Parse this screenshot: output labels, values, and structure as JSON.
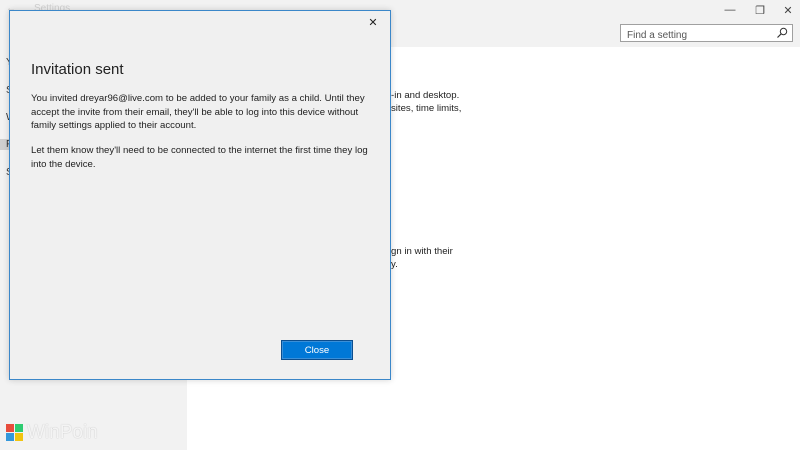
{
  "window": {
    "title": "Settings",
    "minimize_glyph": "—",
    "maximize_glyph": "❐",
    "close_glyph": "✕"
  },
  "search": {
    "placeholder": "Find a setting",
    "icon": "search-icon"
  },
  "sidebar": {
    "letters": [
      "Y",
      "S",
      "W",
      "F",
      "S"
    ]
  },
  "background_text": {
    "line1": "-in and desktop.",
    "line2": "sites, time limits,",
    "line3": "gn in with their",
    "line4": "y."
  },
  "dialog": {
    "close_glyph": "✕",
    "title": "Invitation sent",
    "para1_line1": "You invited dreyar96@live.com to be added to your family as a child. Until they",
    "para1_line2": "accept the invite from their email, they'll be able to log into this device without",
    "para1_line3": "family settings applied to their account.",
    "para2_line1": "Let them know they'll need to be connected to the internet the first time they log",
    "para2_line2": "into the device.",
    "close_button": "Close"
  },
  "watermark": {
    "text": "WinPoin",
    "colors": [
      "#e74c3c",
      "#2ecc71",
      "#3498db",
      "#f1c40f"
    ]
  },
  "colors": {
    "accent": "#0078d7",
    "dialog_border": "#3b87c9"
  }
}
